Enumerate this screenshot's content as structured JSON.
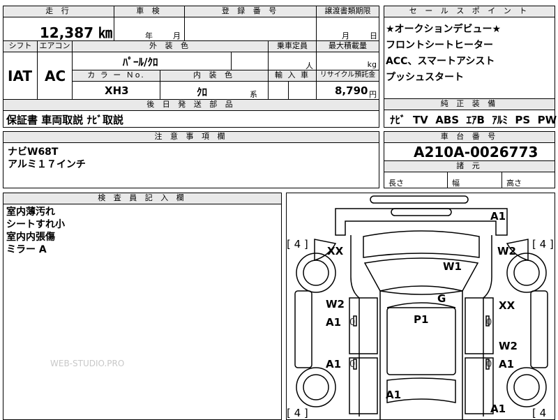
{
  "top_row": {
    "mileage_label": "走 行",
    "mileage_value": "12,387 ㎞",
    "inspection_label": "車 検",
    "year_label": "年",
    "month_label": "月",
    "registration_label": "登 録 番 号",
    "transfer_label": "譲渡書類期限",
    "transfer_month": "月",
    "transfer_day": "日"
  },
  "spec_row": {
    "shift_label": "シフト",
    "shift_value": "IAT",
    "aircon_label": "エアコン",
    "aircon_value": "AC",
    "exterior_color_label": "外 装 色",
    "exterior_color_value": "ﾊﾟｰﾙ/ｸﾛ",
    "capacity_label": "乗車定員",
    "capacity_unit": "人",
    "max_load_label": "最大積載量",
    "max_load_unit": "kg",
    "color_no_label": "カ ラ ー Ｎo.",
    "color_no_value": "XH3",
    "interior_color_label": "内 装 色",
    "interior_color_value": "ｸﾛ",
    "interior_suffix": "系",
    "import_label": "輸 入 車",
    "recycle_label": "リサイクル預託金",
    "recycle_value": "8,790",
    "recycle_unit": "円"
  },
  "later_parts": {
    "label": "後 日 発 送 部 品",
    "value": "保証書 車両取説 ﾅﾋﾞ取説"
  },
  "notes": {
    "label": "注 意 事 項 欄",
    "lines": [
      "ナビW68T",
      "アルミ１７インチ"
    ]
  },
  "sales_points": {
    "label": "セ ー ル ス ポ イ ン ト",
    "lines": [
      "★オークションデビュー★",
      "フロントシートヒーター",
      "ACC、スマートアシスト",
      "プッシュスタート"
    ]
  },
  "equipment": {
    "label": "純 正 装 備",
    "value": "ﾅﾋﾞ  TV  ABS  ｴｱB  ｱﾙﾐ  PS  PW"
  },
  "chassis": {
    "label": "車 台 番 号",
    "value": "A210A-0026773"
  },
  "dimensions": {
    "label": "諸 元",
    "length_label": "長さ",
    "width_label": "幅",
    "height_label": "高さ"
  },
  "inspector": {
    "label": "検 査 員 記 入 欄",
    "lines": [
      "室内薄汚れ",
      "シートすれ小",
      "室内内張傷",
      "ミラー A"
    ]
  },
  "diagram": {
    "marks": {
      "a1_top": "A1",
      "tire_fl": "[ 4 ]",
      "tire_fr": "[ 4 ]",
      "xx_left": "XX",
      "w2_right_top": "W2",
      "w1": "W1",
      "g": "G",
      "w2_left": "W2",
      "xx_right": "XX",
      "a1_left_a": "A1",
      "p1": "P1",
      "w2_right_mid": "W2",
      "a1_left_b": "A1",
      "a1_right_b": "A1",
      "a1_bottom": "A1",
      "a1_bottom_right": "A1",
      "tire_rl": "[ 4 ]",
      "tire_rr": "[ 4"
    },
    "small_marks": {
      "o1": "0",
      "o2": "0",
      "o3": "0",
      "o4": "0"
    }
  },
  "watermark": "WEB-STUDIO.PRO"
}
